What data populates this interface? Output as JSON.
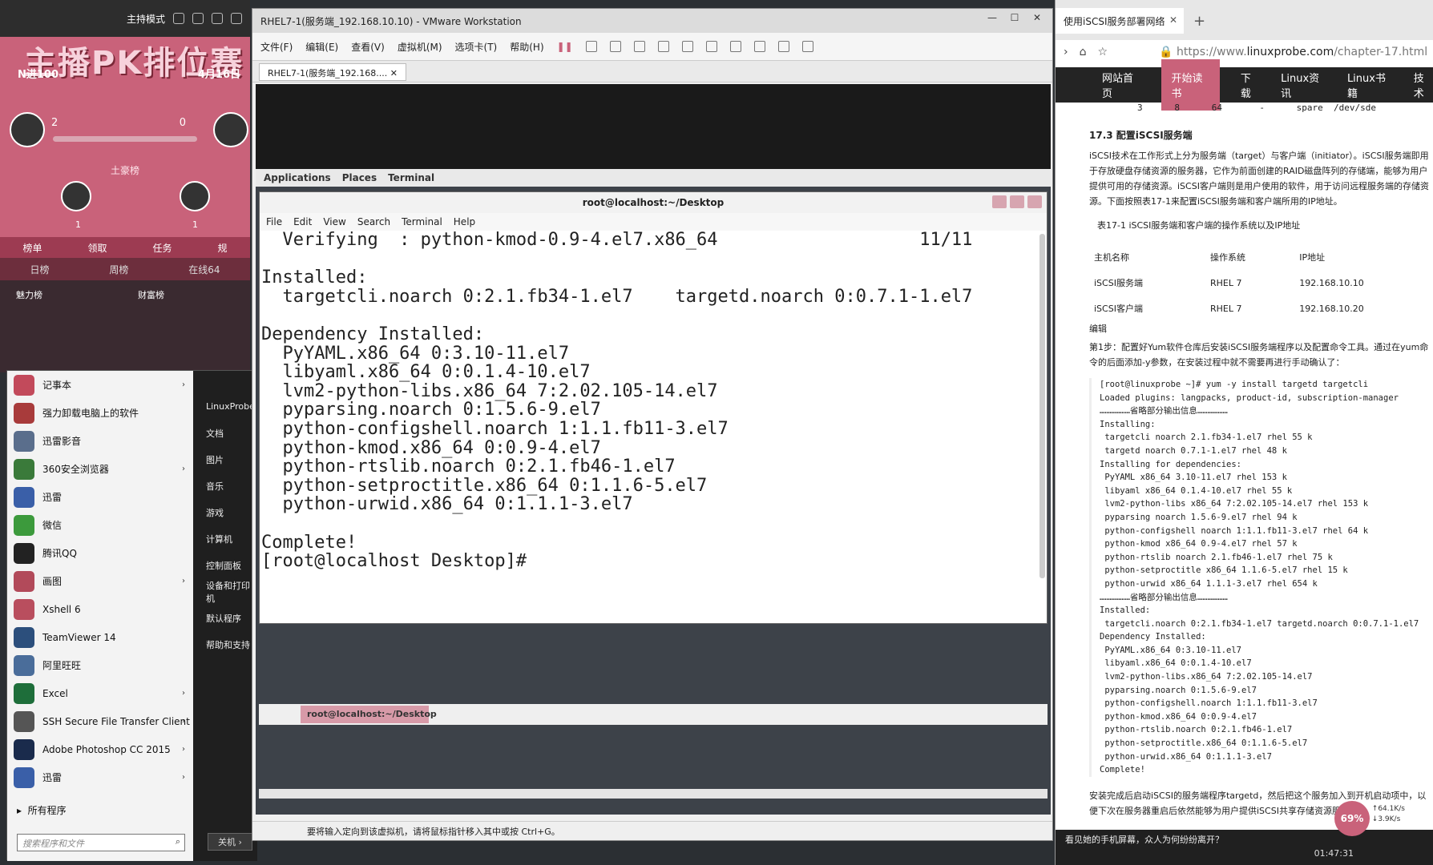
{
  "stream": {
    "mode_label": "主持模式",
    "banner": "主播PK排位赛",
    "vs_label": "N进100",
    "date_label": "4月16日",
    "left_score": "2",
    "right_score": "0",
    "ranking_title": "土豪榜",
    "rank_count_1": "1",
    "rank_count_2": "1",
    "tabs": [
      "榜单",
      "领取",
      "任务",
      "规"
    ],
    "subtabs": [
      "日榜",
      "周榜",
      "在线64"
    ],
    "boards": [
      "魅力榜",
      "财富榜"
    ]
  },
  "start_menu": {
    "items": [
      {
        "label": "记事本",
        "arrow": "›",
        "color": "#c24a5b"
      },
      {
        "label": "强力卸载电脑上的软件",
        "arrow": "",
        "color": "#a83b3b"
      },
      {
        "label": "迅雷影音",
        "arrow": "",
        "color": "#5a6e8c"
      },
      {
        "label": "360安全浏览器",
        "arrow": "›",
        "color": "#3a7a3a"
      },
      {
        "label": "迅雷",
        "arrow": "",
        "color": "#3a5fa8"
      },
      {
        "label": "微信",
        "arrow": "",
        "color": "#3c9a3c"
      },
      {
        "label": "腾讯QQ",
        "arrow": "",
        "color": "#222222"
      },
      {
        "label": "画图",
        "arrow": "›",
        "color": "#b24a5a"
      },
      {
        "label": "Xshell 6",
        "arrow": "",
        "color": "#b94e5e"
      },
      {
        "label": "TeamViewer 14",
        "arrow": "",
        "color": "#2c4f7c"
      },
      {
        "label": "阿里旺旺",
        "arrow": "",
        "color": "#4a6d9a"
      },
      {
        "label": "Excel",
        "arrow": "›",
        "color": "#1e6e3a"
      },
      {
        "label": "SSH Secure File Transfer Client",
        "arrow": "›",
        "color": "#555555"
      },
      {
        "label": "Adobe Photoshop CC 2015",
        "arrow": "›",
        "color": "#1a2b4c"
      },
      {
        "label": "迅雷",
        "arrow": "›",
        "color": "#3a5fa8"
      }
    ],
    "all_programs": "所有程序",
    "search_placeholder": "搜索程序和文件",
    "right_items": [
      "LinuxProbe",
      "文档",
      "图片",
      "音乐",
      "游戏",
      "计算机",
      "控制面板",
      "设备和打印机",
      "默认程序",
      "帮助和支持"
    ],
    "shutdown": "关机"
  },
  "vmware": {
    "title": "RHEL7-1(服务端_192.168.10.10) - VMware Workstation",
    "menus": [
      "文件(F)",
      "编辑(E)",
      "查看(V)",
      "虚拟机(M)",
      "选项卡(T)",
      "帮助(H)"
    ],
    "vm_tab": "RHEL7-1(服务端_192.168....",
    "status": "要将输入定向到该虚拟机，请将鼠标指针移入其中或按 Ctrl+G。"
  },
  "guest": {
    "panel": [
      "Applications",
      "Places",
      "Terminal"
    ],
    "taskbar_item": "root@localhost:~/Desktop"
  },
  "terminal": {
    "title": "root@localhost:~/Desktop",
    "menus": [
      "File",
      "Edit",
      "View",
      "Search",
      "Terminal",
      "Help"
    ],
    "lines": [
      "  Verifying  : python-kmod-0.9-4.el7.x86_64                   11/11",
      "",
      "Installed:",
      "  targetcli.noarch 0:2.1.fb34-1.el7    targetd.noarch 0:0.7.1-1.el7",
      "",
      "Dependency Installed:",
      "  PyYAML.x86_64 0:3.10-11.el7",
      "  libyaml.x86_64 0:0.1.4-10.el7",
      "  lvm2-python-libs.x86_64 7:2.02.105-14.el7",
      "  pyparsing.noarch 0:1.5.6-9.el7",
      "  python-configshell.noarch 1:1.1.fb11-3.el7",
      "  python-kmod.x86_64 0:0.9-4.el7",
      "  python-rtslib.noarch 0:2.1.fb46-1.el7",
      "  python-setproctitle.x86_64 0:1.1.6-5.el7",
      "  python-urwid.x86_64 0:1.1.1-3.el7",
      "",
      "Complete!",
      "[root@localhost Desktop]# "
    ]
  },
  "browser": {
    "tab_title": "使用iSCSI服务部署网络",
    "url_prefix": "https://www.",
    "url_domain": "linuxprobe.com",
    "url_path": "/chapter-17.html",
    "nav": [
      "网站首页",
      "开始读书",
      "下载",
      "Linux资讯",
      "Linux书籍",
      "技术"
    ],
    "raid_row": "3      8      64       -      spare  /dev/sde",
    "heading": "17.3 配置iSCSI服务端",
    "para1": "iSCSI技术在工作形式上分为服务端（target）与客户端（initiator）。iSCSI服务端即用于存放硬盘存储资源的服务器，它作为前面创建的RAID磁盘阵列的存储端，能够为用户提供可用的存储资源。iSCSI客户端则是用户使用的软件，用于访问远程服务端的存储资源。下面按照表17-1来配置iSCSI服务端和客户端所用的IP地址。",
    "table_caption": "表17-1          iSCSI服务端和客户端的操作系统以及IP地址",
    "table_head": [
      "主机名称",
      "操作系统",
      "IP地址"
    ],
    "table_rows": [
      [
        "iSCSI服务端",
        "RHEL 7",
        "192.168.10.10"
      ],
      [
        "iSCSI客户端",
        "RHEL 7",
        "192.168.10.20"
      ]
    ],
    "edit": "编辑",
    "step1": "第1步：配置好Yum软件仓库后安装iSCSI服务端程序以及配置命令工具。通过在yum命令的后面添加-y参数，在安装过程中就不需要再进行手动确认了：",
    "code": "[root@linuxprobe ~]# yum -y install targetd targetcli\nLoaded plugins: langpacks, product-id, subscription-manager\n………………省略部分输出信息………………\nInstalling:\n targetcli noarch 2.1.fb34-1.el7 rhel 55 k\n targetd noarch 0.7.1-1.el7 rhel 48 k\nInstalling for dependencies:\n PyYAML x86_64 3.10-11.el7 rhel 153 k\n libyaml x86_64 0.1.4-10.el7 rhel 55 k\n lvm2-python-libs x86_64 7:2.02.105-14.el7 rhel 153 k\n pyparsing noarch 1.5.6-9.el7 rhel 94 k\n python-configshell noarch 1:1.1.fb11-3.el7 rhel 64 k\n python-kmod x86_64 0.9-4.el7 rhel 57 k\n python-rtslib noarch 2.1.fb46-1.el7 rhel 75 k\n python-setproctitle x86_64 1.1.6-5.el7 rhel 15 k\n python-urwid x86_64 1.1.1-3.el7 rhel 654 k\n………………省略部分输出信息………………\nInstalled:\n targetcli.noarch 0:2.1.fb34-1.el7 targetd.noarch 0:0.7.1-1.el7\nDependency Installed:\n PyYAML.x86_64 0:3.10-11.el7\n libyaml.x86_64 0:0.1.4-10.el7\n lvm2-python-libs.x86_64 7:2.02.105-14.el7\n pyparsing.noarch 0:1.5.6-9.el7\n python-configshell.noarch 1:1.1.fb11-3.el7\n python-kmod.x86_64 0:0.9-4.el7\n python-rtslib.noarch 0:2.1.fb46-1.el7\n python-setproctitle.x86_64 0:1.1.6-5.el7\n python-urwid.x86_64 0:1.1.1-3.el7\nComplete!",
    "after": "安装完成后启动iSCSI的服务端程序targetd，然后把这个服务加入到开机启动项中，以便下次在服务器重启后依然能够为用户提供iSCSI共享存储资源服务：",
    "notice": "看见她的手机屏幕，众人为何纷纷离开？",
    "cpu": "69%",
    "net_up": "64.1K/s",
    "net_down": "3.9K/s",
    "clock": "01:47:31"
  }
}
